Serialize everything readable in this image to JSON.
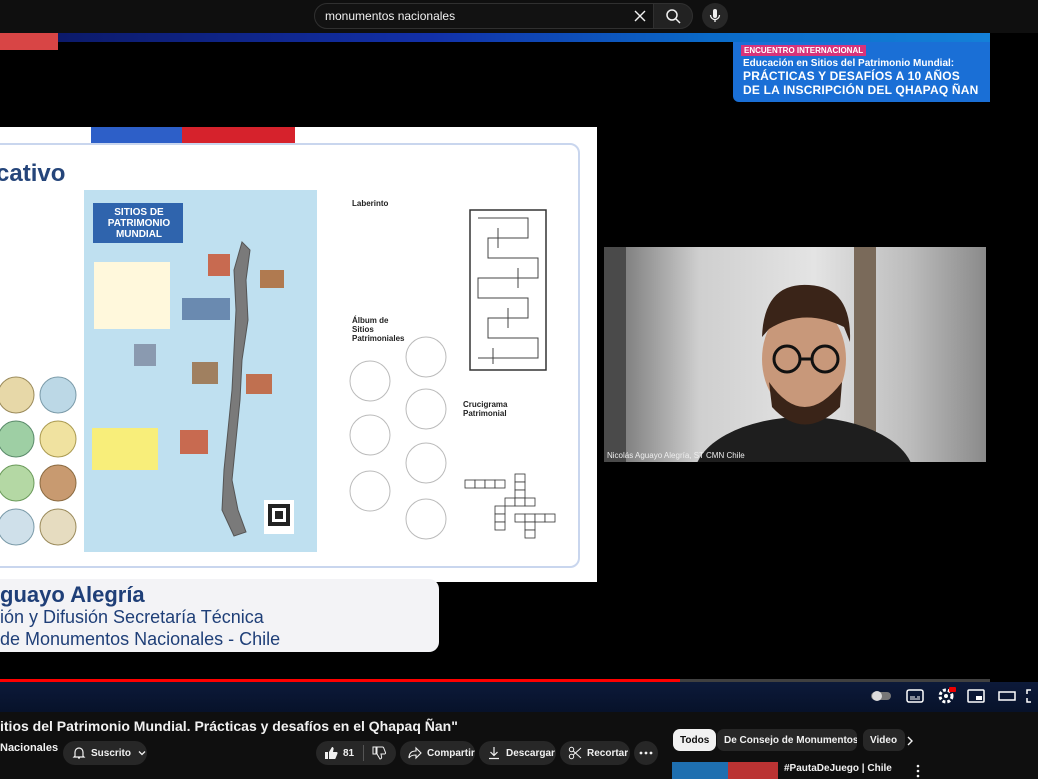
{
  "search": {
    "query": "monumentos nacionales"
  },
  "banner": {
    "tag": "ENCUENTRO INTERNACIONAL",
    "line1": "Educación en Sitios del Patrimonio Mundial:",
    "line2": "PRÁCTICAS Y DESAFÍOS A 10 AÑOS",
    "line3": "DE LA INSCRIPCIÓN DEL QHAPAQ ÑAN"
  },
  "slide": {
    "title": "cativo",
    "map_title": "SITIOS DE PATRIMONIO MUNDIAL",
    "worksheet": {
      "labyrinth": "Laberinto",
      "album": "Álbum de Sitios Patrimoniales",
      "crossword": "Crucigrama Patrimonial"
    }
  },
  "nameplate": {
    "name": "guayo Alegría",
    "role1": "ión y Difusión Secretaría Técnica",
    "role2": "de Monumentos Nacionales - Chile"
  },
  "webcam": {
    "label": "Nicolás Aguayo Alegría, ST CMN Chile"
  },
  "player": {
    "progress": 0.687
  },
  "video": {
    "title": "itios del Patrimonio Mundial. Prácticas y desafíos en el Qhapaq Ñan\"",
    "channel": "Nacionales",
    "subscribe_label": "Suscrito",
    "like_count": "81",
    "share_label": "Compartir",
    "download_label": "Descargar",
    "clip_label": "Recortar"
  },
  "chips": [
    "Todos",
    "De Consejo de Monumentos N...",
    "Video"
  ],
  "related": {
    "title": "#PautaDeJuego | Chile"
  },
  "colors": {
    "accent": "#ff0000",
    "banner": "#1a6fd6",
    "slide_blue": "#25457a"
  }
}
